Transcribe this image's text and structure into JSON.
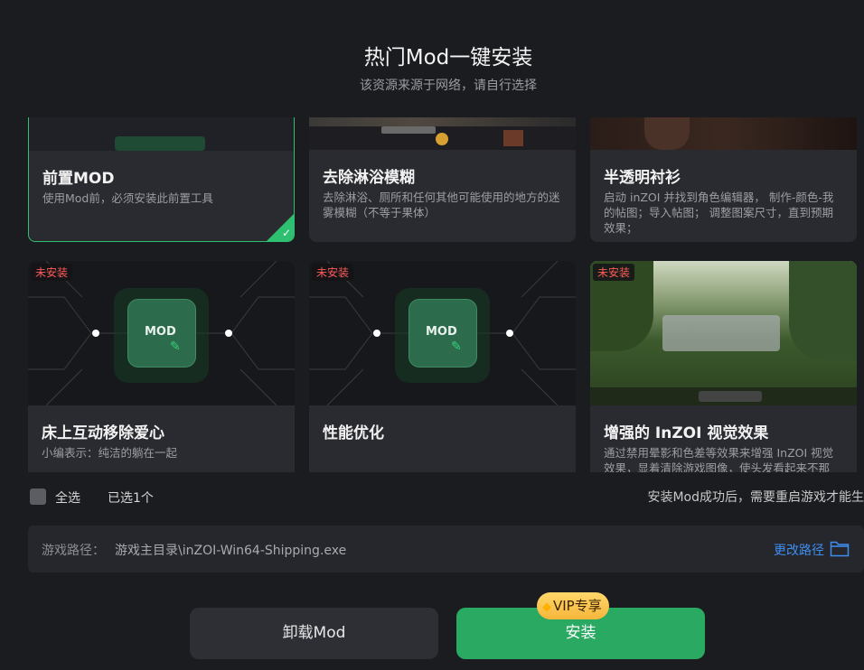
{
  "header": {
    "title": "热门Mod一键安装",
    "subtitle": "该资源来源于网络，请自行选择"
  },
  "cards": [
    {
      "title": "前置MOD",
      "desc": "使用Mod前，必须安装此前置工具",
      "selected": true
    },
    {
      "title": "去除淋浴模糊",
      "desc": "去除淋浴、厕所和任何其他可能使用的地方的迷雾模糊（不等于果体）"
    },
    {
      "title": "半透明衬衫",
      "desc": "启动 inZOI 并找到角色编辑器， 制作-颜色-我的帖图；导入帖图； 调整图案尺寸，直到预期效果；"
    },
    {
      "title": "床上互动移除爱心",
      "desc": "小编表示：纯洁的躺在一起",
      "badge": "未安装",
      "icon": "mod-file-icon",
      "icon_text": "MOD"
    },
    {
      "title": "性能优化",
      "desc": "",
      "badge": "未安装",
      "icon": "mod-file-icon",
      "icon_text": "MOD"
    },
    {
      "title": "增强的 InZOI 视觉效果",
      "desc": "通过禁用晕影和色差等效果来增强 InZOI 视觉效果，显着清除游戏图像，使头发看起来不那",
      "badge": "未安装"
    }
  ],
  "footer": {
    "select_all": "全选",
    "selected_count": "已选1个",
    "notice": "安装Mod成功后，需要重启游戏才能生效"
  },
  "path": {
    "label": "游戏路径：",
    "value": "游戏主目录\\inZOI-Win64-Shipping.exe",
    "change": "更改路径",
    "icon": "folder-icon"
  },
  "buttons": {
    "uninstall": "卸载Mod",
    "install": "安装",
    "vip": "VIP专享",
    "vip_icon": "diamond-icon"
  },
  "colors": {
    "accent": "#2aa962",
    "selected_border": "#2fbf71",
    "badge_text": "#ff5a5a",
    "link": "#3e8ef0",
    "vip_bg": "#f5b63a"
  }
}
